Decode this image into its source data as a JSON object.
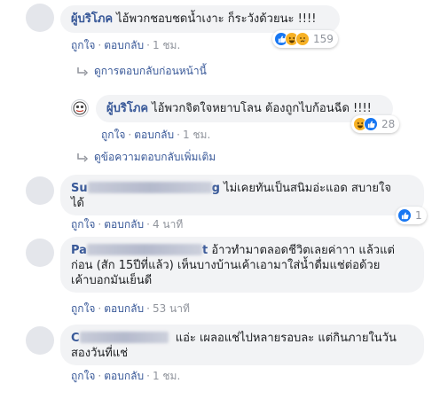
{
  "actions": {
    "like": "ถูกใจ",
    "reply": "ตอบกลับ",
    "separator": "·"
  },
  "comments": [
    {
      "author": "ผู้บริโภค",
      "text": "ไอ้พวกชอบชดน้ำเงาะ ก็ระวังด้วยนะ !!!!",
      "time": "1 ชม.",
      "reactions": [
        "like",
        "haha",
        "sad"
      ],
      "reaction_count": "159"
    },
    {
      "author": "ผู้บริโภค",
      "text": "ไอ้พวกจิตใจหยาบโลน ต้องถูกไบก้อนฉีด !!!!",
      "time": "1 ชม.",
      "reactions": [
        "haha",
        "like"
      ],
      "reaction_count": "28"
    },
    {
      "author_visible_start": "Su",
      "author_visible_end": "g",
      "text_line1": "ไม่เคยทันเป็นสนิมอ่ะแอด สบายใจ",
      "text_line2": "ได้",
      "time": "4 นาที",
      "reactions": [
        "like"
      ],
      "reaction_count": "1"
    },
    {
      "author_visible_start": "Pa",
      "author_visible_end": "t",
      "text_line1": "อ้าวทำมาตลอดชีวิตเลยค่าาา แล้วแต่",
      "text_line2": "ก่อน (สัก 15ปีที่แล้ว) เห็นบางบ้านเค้าเอามาใส่น้ำดื่มแช่ต่อด้วย",
      "text_line3": "เค้าบอกมันเย็นดี",
      "time": "53 นาที"
    },
    {
      "author_visible_start": "C",
      "text_line1": "แอ่ะ เผลอแช่ไปหลายรอบละ แต่กินภายในวัน",
      "text_line2": "สองวันที่แช่",
      "time": "1 ชม."
    }
  ],
  "links": {
    "previous_replies": "ดูการตอบกลับก่อนหน้านี้",
    "more_replies": "ดูข้อความตอบกลับเพิ่มเติม"
  },
  "colors": {
    "link": "#385898",
    "meta": "#90949c",
    "bubble": "#f2f3f5",
    "like": "#1877f2",
    "emoji": "#f7b125"
  }
}
